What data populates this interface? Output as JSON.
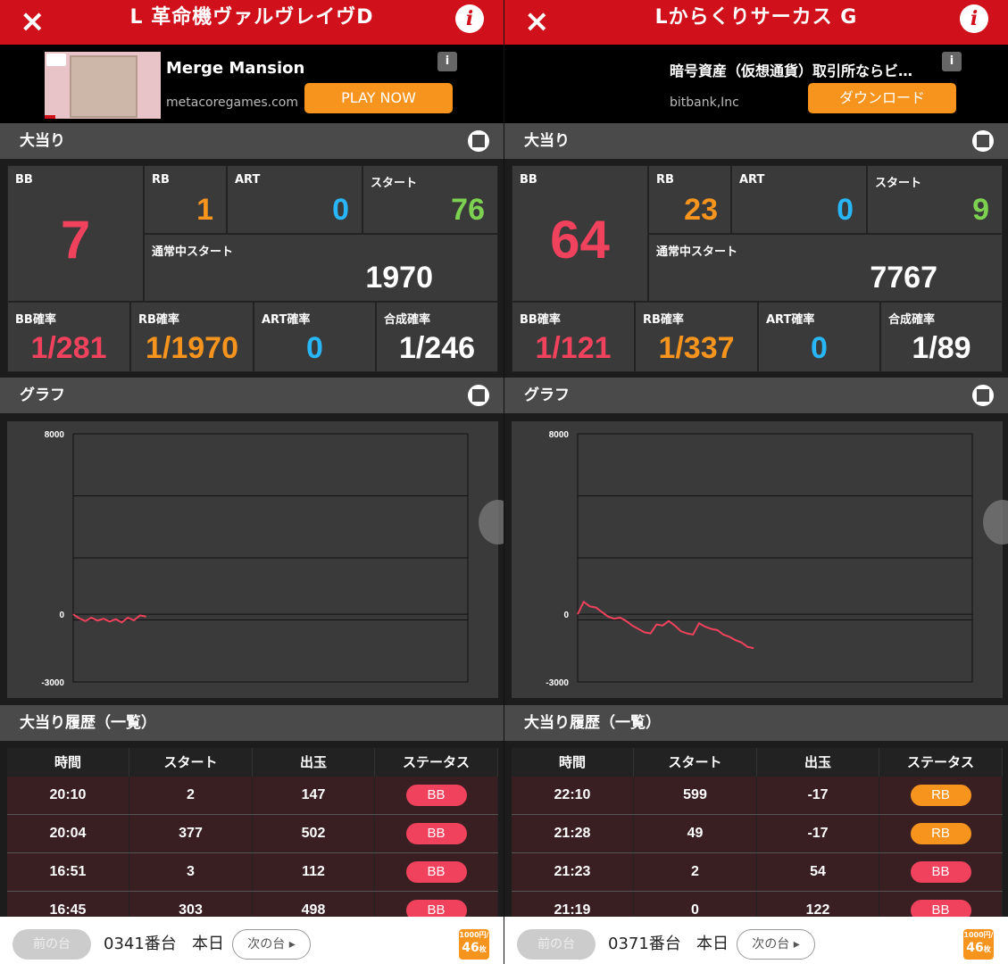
{
  "colors": {
    "header_red": "#d0111b",
    "bb": "#f0425c",
    "rb": "#f7941d",
    "art": "#29b6f6",
    "start": "#7cd250",
    "badge_bb": "#f0425c",
    "badge_rb": "#f7941d",
    "graph_line": "#f0425c"
  },
  "common": {
    "close_icon": "×",
    "info_icon": "i",
    "ad_info": "i",
    "section_bonus": "大当り",
    "section_graph": "グラフ",
    "section_history": "大当り履歴（一覧）",
    "labels": {
      "bb": "BB",
      "rb": "RB",
      "art": "ART",
      "start": "スタート",
      "normal_start": "通常中スタート",
      "bb_rate": "BB確率",
      "rb_rate": "RB確率",
      "art_rate": "ART確率",
      "combined_rate": "合成確率"
    },
    "history_headers": [
      "時間",
      "スタート",
      "出玉",
      "ステータス"
    ],
    "prev_label": "前の台",
    "next_label": "次の台 ▸",
    "today_label": "本日",
    "coin_top": "1000円/",
    "coin_value": "46",
    "coin_unit": "枚",
    "y_ticks": [
      "8000",
      "0",
      "-3000"
    ]
  },
  "panels": [
    {
      "title": "L 革命機ヴァルヴレイヴD",
      "ad": {
        "headline": "Merge Mansion",
        "domain": "metacoregames.com",
        "cta": "PLAY NOW"
      },
      "stats": {
        "bb": "7",
        "rb": "1",
        "art": "0",
        "start": "76",
        "normal_start": "1970",
        "bb_rate": "1/281",
        "rb_rate": "1/1970",
        "art_rate": "0",
        "combined_rate": "1/246"
      },
      "chart_data": {
        "type": "line",
        "ylim": [
          -3000,
          8000
        ],
        "ticks": [
          8000,
          0,
          -3000
        ],
        "values": [
          0,
          -180,
          -300,
          -150,
          -280,
          -200,
          -320,
          -220,
          -360,
          -150,
          -270,
          -50,
          -100
        ]
      },
      "history": [
        {
          "time": "20:10",
          "start": "2",
          "payout": "147",
          "status": "BB"
        },
        {
          "time": "20:04",
          "start": "377",
          "payout": "502",
          "status": "BB"
        },
        {
          "time": "16:51",
          "start": "3",
          "payout": "112",
          "status": "BB"
        },
        {
          "time": "16:45",
          "start": "303",
          "payout": "498",
          "status": "BB"
        }
      ],
      "machine_no": "0341番台"
    },
    {
      "title": "Lからくりサーカス G",
      "ad": {
        "headline": "暗号資産（仮想通貨）取引所ならビ…",
        "domain": "bitbank,Inc",
        "cta": "ダウンロード"
      },
      "stats": {
        "bb": "64",
        "rb": "23",
        "art": "0",
        "start": "9",
        "normal_start": "7767",
        "bb_rate": "1/121",
        "rb_rate": "1/337",
        "art_rate": "0",
        "combined_rate": "1/89"
      },
      "chart_data": {
        "type": "line",
        "ylim": [
          -3000,
          8000
        ],
        "ticks": [
          8000,
          0,
          -3000
        ],
        "values": [
          0,
          550,
          350,
          300,
          100,
          -100,
          -200,
          -150,
          -300,
          -500,
          -650,
          -800,
          -850,
          -450,
          -500,
          -300,
          -500,
          -750,
          -850,
          -900,
          -400,
          -550,
          -650,
          -700,
          -900,
          -1000,
          -1150,
          -1250,
          -1450,
          -1500
        ]
      },
      "history": [
        {
          "time": "22:10",
          "start": "599",
          "payout": "-17",
          "status": "RB"
        },
        {
          "time": "21:28",
          "start": "49",
          "payout": "-17",
          "status": "RB"
        },
        {
          "time": "21:23",
          "start": "2",
          "payout": "54",
          "status": "BB"
        },
        {
          "time": "21:19",
          "start": "0",
          "payout": "122",
          "status": "BB"
        }
      ],
      "machine_no": "0371番台"
    }
  ]
}
